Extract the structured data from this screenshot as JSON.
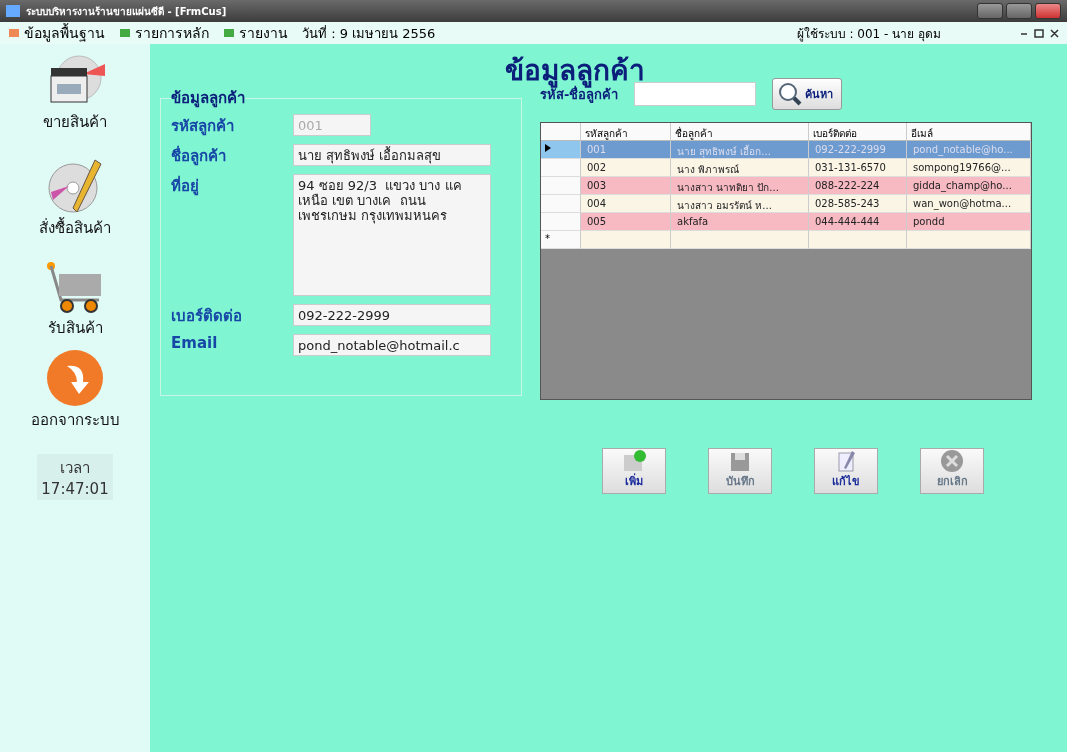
{
  "window": {
    "title": "ระบบบริหารงานร้านขายแผ่นซีดี - [FrmCus]"
  },
  "menu": {
    "items": [
      {
        "label": "ข้อมูลพื้นฐาน"
      },
      {
        "label": "รายการหลัก"
      },
      {
        "label": "รายงาน"
      }
    ],
    "date": "วันที่ : 9 เมษายน 2556",
    "user": "ผู้ใช้ระบบ : 001 - นาย อุดม"
  },
  "sidebar": {
    "items": [
      {
        "kind": "dvd",
        "label": "ขายสินค้า"
      },
      {
        "kind": "disc",
        "label": "สั่งซื้อสินค้า"
      },
      {
        "kind": "cart",
        "label": "รับสินค้า"
      },
      {
        "kind": "exit",
        "label": "ออกจากระบบ"
      }
    ],
    "time_label": "เวลา",
    "time": "17:47:01"
  },
  "heading": "ข้อมูลลูกค้า",
  "form": {
    "title": "ข้อมูลลูกค้า",
    "fields": [
      {
        "label": "รหัสลูกค้า",
        "value": "001",
        "disabled": true,
        "kind": "text"
      },
      {
        "label": "ชื่อลูกค้า",
        "value": "นาย สุทธิพงษ์ เอื้อกมลสุข",
        "disabled": false,
        "kind": "text"
      },
      {
        "label": "ที่อยู่",
        "value": "94 ซอย 92/3  แขวง บาง แคเหนือ เขต บางเค  ถนน เพชรเกษม กรุงเทพมหนคร",
        "disabled": false,
        "kind": "multiline"
      },
      {
        "label": "เบอร์ติดต่อ",
        "value": "092-222-2999",
        "disabled": false,
        "kind": "text"
      },
      {
        "label": "Email",
        "value": "pond_notable@hotmail.c",
        "disabled": false,
        "kind": "text"
      }
    ]
  },
  "search": {
    "label": "รหัส-ชื่อลูกค้า",
    "button": "ค้นหา"
  },
  "table": {
    "columns": [
      "รหัสลูกค้า",
      "ชื่อลูกค้า",
      "เบอร์ติดต่อ",
      "อีเมล์"
    ],
    "new_row_marker": "*",
    "rows": [
      {
        "selected": true,
        "cells": [
          "001",
          "นาย สุทธิพงษ์ เอื้อก...",
          "092-222-2999",
          "pond_notable@ho..."
        ]
      },
      {
        "selected": false,
        "color": "#fbf5e6",
        "cells": [
          "002",
          "นาง พิภาพรณ์",
          "031-131-6570",
          "sompong19766@..."
        ]
      },
      {
        "selected": false,
        "color": "#f7b9c2",
        "cells": [
          "003",
          "นางสาว นาทติยา ปัก...",
          "088-222-224",
          "gidda_champ@ho..."
        ]
      },
      {
        "selected": false,
        "color": "#fbf5e6",
        "cells": [
          "004",
          "นางสาว อมรรัตน์ ห...",
          "028-585-243",
          "wan_won@hotma..."
        ]
      },
      {
        "selected": false,
        "color": "#f7b9c2",
        "cells": [
          "005",
          "akfafa",
          "044-444-444",
          "pondd"
        ]
      }
    ]
  },
  "buttons": [
    {
      "kind": "add",
      "label": "เพิ่ม",
      "disabled": false
    },
    {
      "kind": "save",
      "label": "บันทึก",
      "disabled": true
    },
    {
      "kind": "edit",
      "label": "แก้ไข",
      "disabled": false
    },
    {
      "kind": "cancel",
      "label": "ยกเลิก",
      "disabled": true
    }
  ]
}
